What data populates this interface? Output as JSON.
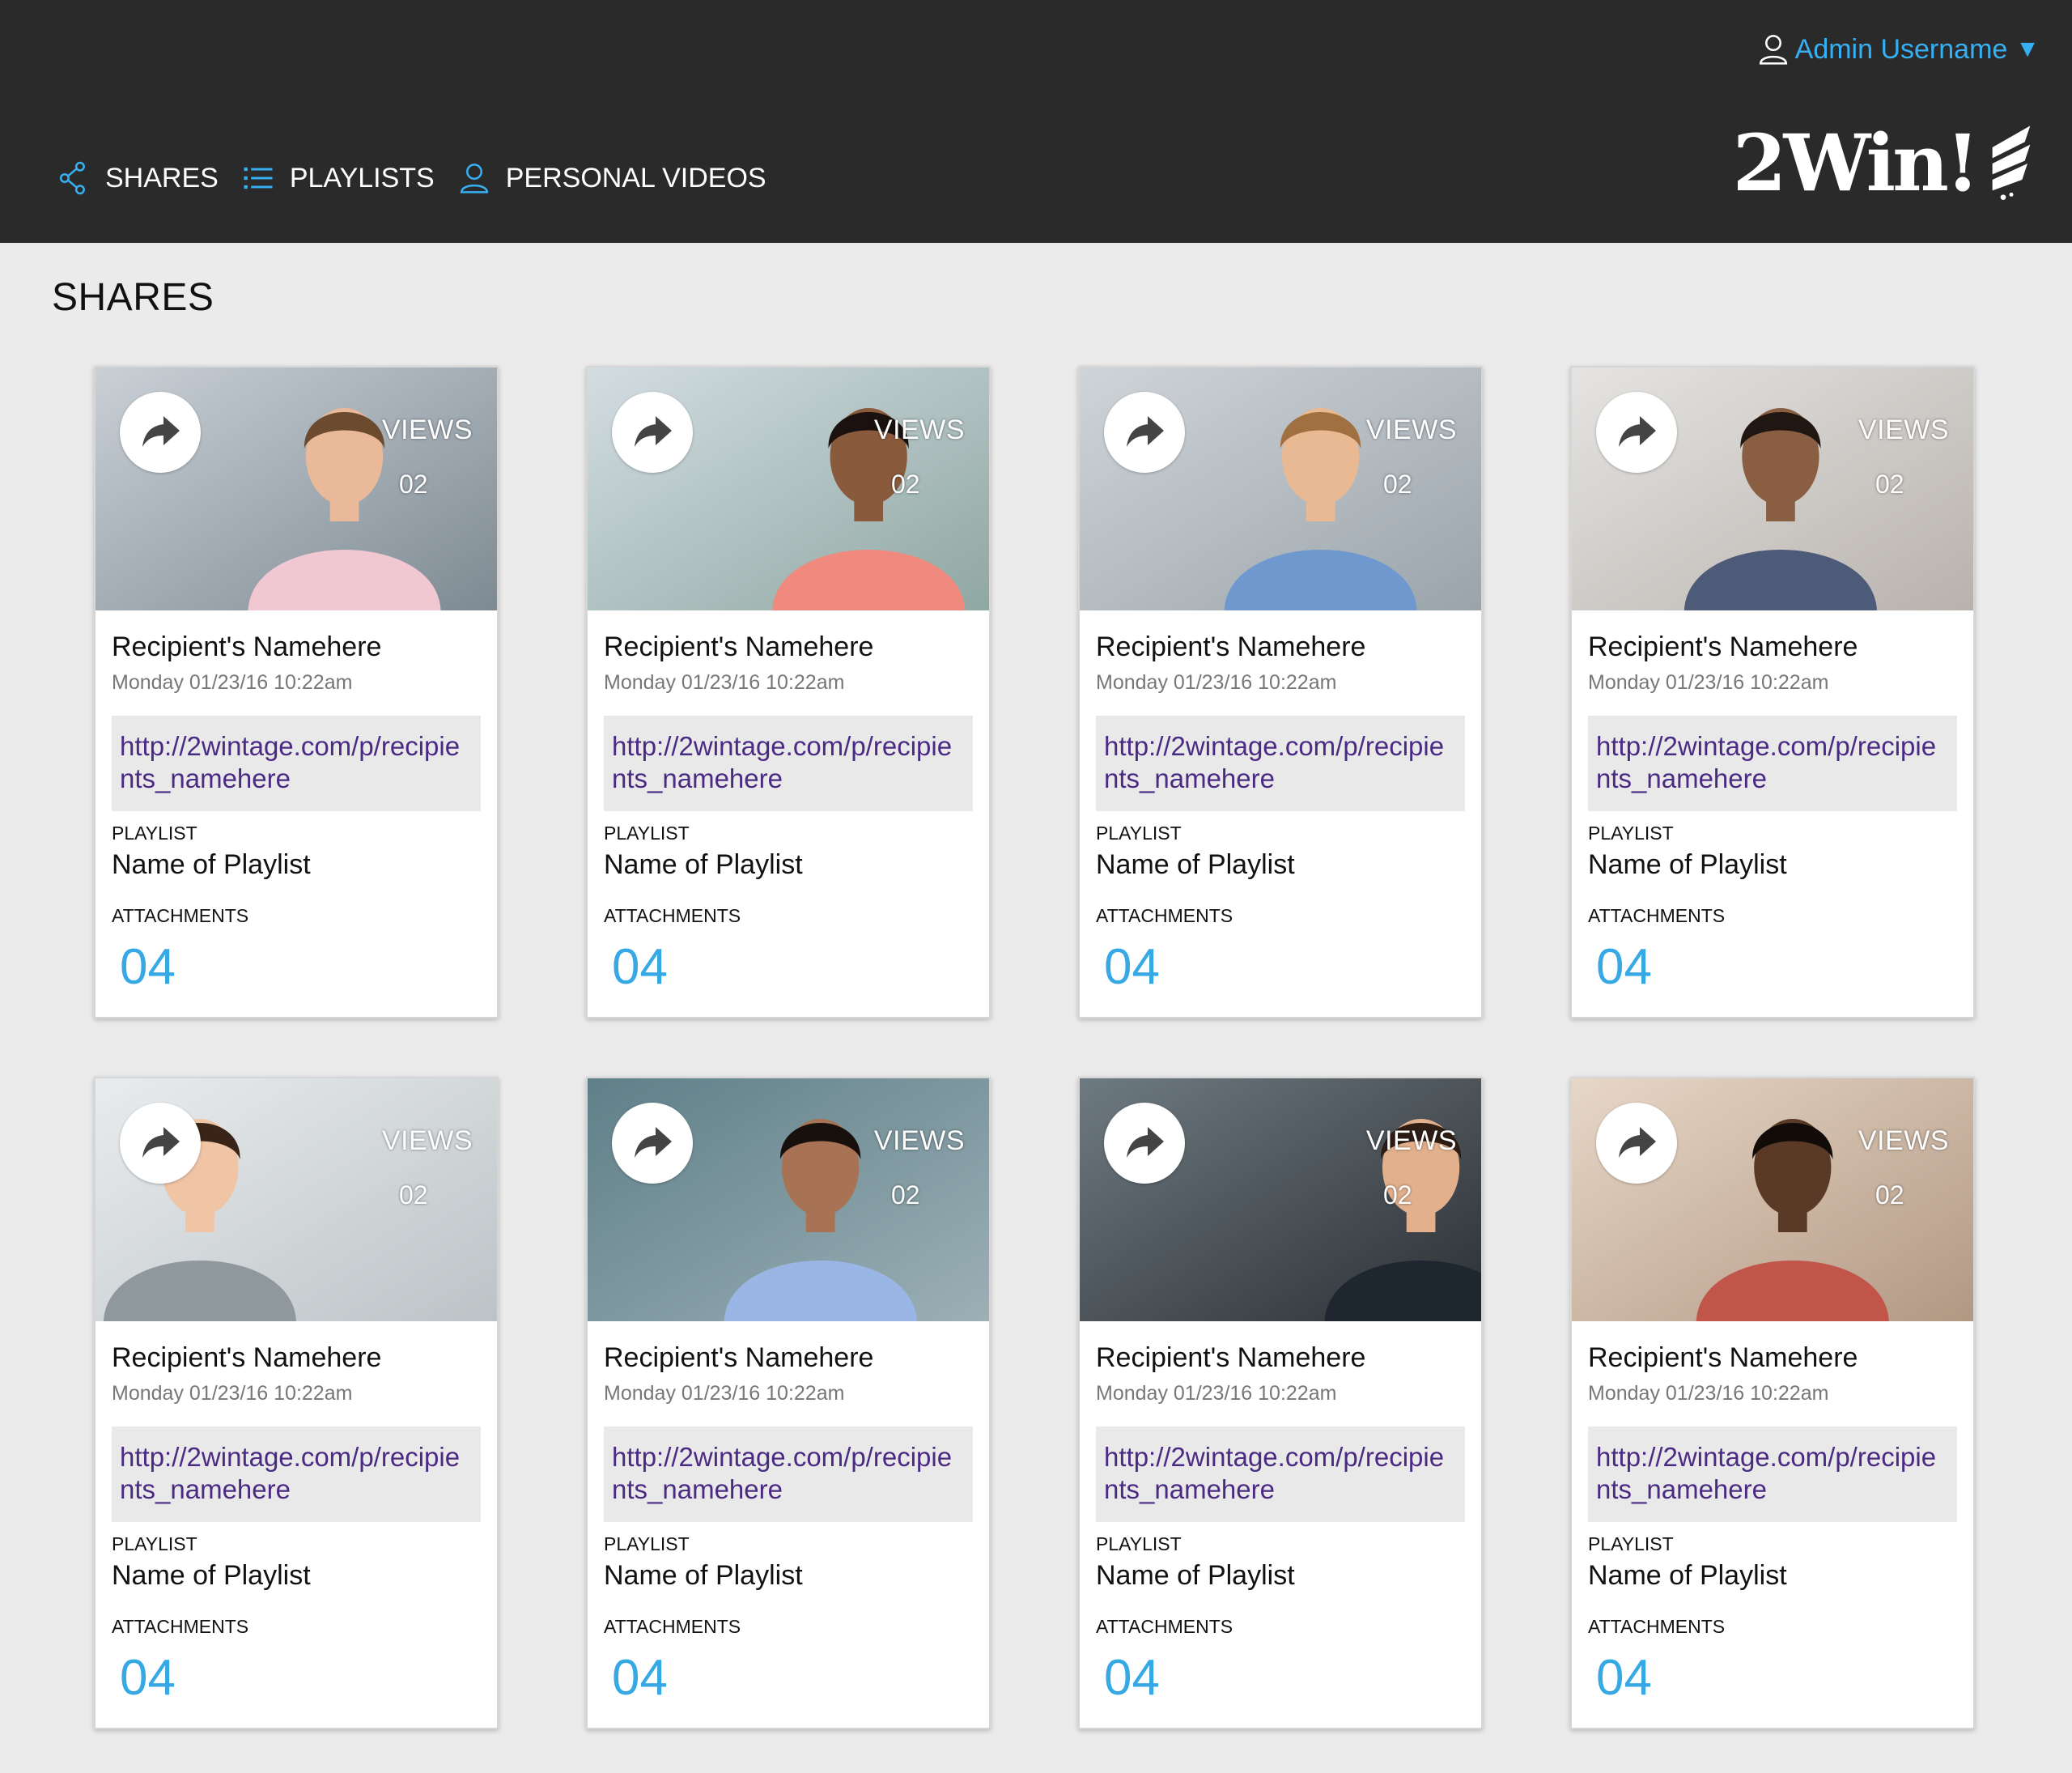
{
  "header": {
    "user_label": "Admin Username",
    "logo_text": "2Win!",
    "nav": [
      {
        "label": "SHARES",
        "icon": "share-icon"
      },
      {
        "label": "PLAYLISTS",
        "icon": "list-icon"
      },
      {
        "label": "PERSONAL VIDEOS",
        "icon": "user-icon"
      }
    ]
  },
  "page": {
    "title": "SHARES"
  },
  "colors": {
    "accent": "#36b0f2",
    "count": "#36a9e5",
    "link": "#4b2a84",
    "topbar": "#2a2a2a"
  },
  "cards": [
    {
      "views_label": "VIEWS",
      "views": "02",
      "recipient": "Recipient's Namehere",
      "date": "Monday 01/23/16 10:22am",
      "link": "http://2wintage.com/p/recipients_namehere",
      "playlist_label": "PLAYLIST",
      "playlist": "Name of Playlist",
      "attachments_label": "ATTACHMENTS",
      "attachments": "04"
    },
    {
      "views_label": "VIEWS",
      "views": "02",
      "recipient": "Recipient's Namehere",
      "date": "Monday 01/23/16 10:22am",
      "link": "http://2wintage.com/p/recipients_namehere",
      "playlist_label": "PLAYLIST",
      "playlist": "Name of Playlist",
      "attachments_label": "ATTACHMENTS",
      "attachments": "04"
    },
    {
      "views_label": "VIEWS",
      "views": "02",
      "recipient": "Recipient's Namehere",
      "date": "Monday 01/23/16 10:22am",
      "link": "http://2wintage.com/p/recipients_namehere",
      "playlist_label": "PLAYLIST",
      "playlist": "Name of Playlist",
      "attachments_label": "ATTACHMENTS",
      "attachments": "04"
    },
    {
      "views_label": "VIEWS",
      "views": "02",
      "recipient": "Recipient's Namehere",
      "date": "Monday 01/23/16 10:22am",
      "link": "http://2wintage.com/p/recipients_namehere",
      "playlist_label": "PLAYLIST",
      "playlist": "Name of Playlist",
      "attachments_label": "ATTACHMENTS",
      "attachments": "04"
    },
    {
      "views_label": "VIEWS",
      "views": "02",
      "recipient": "Recipient's Namehere",
      "date": "Monday 01/23/16 10:22am",
      "link": "http://2wintage.com/p/recipients_namehere",
      "playlist_label": "PLAYLIST",
      "playlist": "Name of Playlist",
      "attachments_label": "ATTACHMENTS",
      "attachments": "04"
    },
    {
      "views_label": "VIEWS",
      "views": "02",
      "recipient": "Recipient's Namehere",
      "date": "Monday 01/23/16 10:22am",
      "link": "http://2wintage.com/p/recipients_namehere",
      "playlist_label": "PLAYLIST",
      "playlist": "Name of Playlist",
      "attachments_label": "ATTACHMENTS",
      "attachments": "04"
    },
    {
      "views_label": "VIEWS",
      "views": "02",
      "recipient": "Recipient's Namehere",
      "date": "Monday 01/23/16 10:22am",
      "link": "http://2wintage.com/p/recipients_namehere",
      "playlist_label": "PLAYLIST",
      "playlist": "Name of Playlist",
      "attachments_label": "ATTACHMENTS",
      "attachments": "04"
    },
    {
      "views_label": "VIEWS",
      "views": "02",
      "recipient": "Recipient's Namehere",
      "date": "Monday 01/23/16 10:22am",
      "link": "http://2wintage.com/p/recipients_namehere",
      "playlist_label": "PLAYLIST",
      "playlist": "Name of Playlist",
      "attachments_label": "ATTACHMENTS",
      "attachments": "04"
    }
  ]
}
